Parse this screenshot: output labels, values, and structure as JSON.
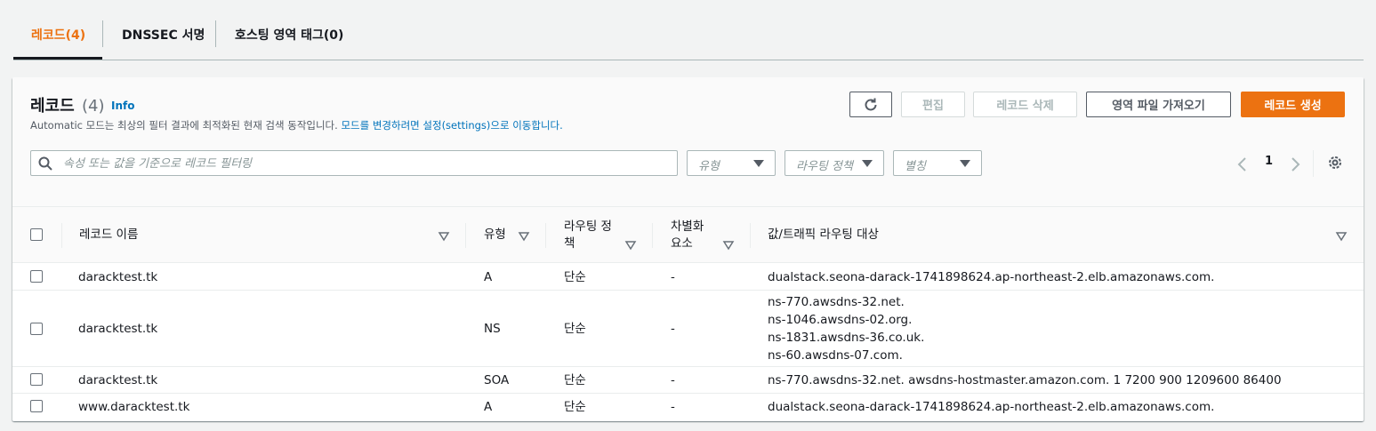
{
  "tabs": [
    {
      "label": "레코드(4)",
      "active": true
    },
    {
      "label": "DNSSEC 서명",
      "active": false
    },
    {
      "label": "호스팅 영역 태그(0)",
      "active": false
    }
  ],
  "panel": {
    "title": "레코드",
    "count": "(4)",
    "info": "Info",
    "description_prefix": "Automatic 모드는 최상의 필터 결과에 최적화된 현재 검색 동작입니다. ",
    "description_link": "모드를 변경하려면 설정(settings)으로 이동합니다."
  },
  "buttons": {
    "refresh_icon": "refresh-icon",
    "edit": "편집",
    "delete": "레코드 삭제",
    "import": "영역 파일 가져오기",
    "create": "레코드 생성"
  },
  "search": {
    "placeholder": "속성 또는 값을 기준으로 레코드 필터링"
  },
  "filters": {
    "type": "유형",
    "routing": "라우팅 정책",
    "alias": "별칭"
  },
  "pagination": {
    "page": "1"
  },
  "columns": {
    "name": "레코드 이름",
    "type": "유형",
    "routing": "라우팅 정책",
    "routing_line1": "라우팅 정",
    "routing_line2": "책",
    "differentiator": "차별화 요소",
    "diff_line1": "차별화",
    "diff_line2": "요소",
    "value": "값/트래픽 라우팅 대상"
  },
  "rows": [
    {
      "name": "daracktest.tk",
      "type": "A",
      "routing": "단순",
      "diff": "-",
      "values": [
        "dualstack.seona-darack-1741898624.ap-northeast-2.elb.amazonaws.com."
      ]
    },
    {
      "name": "daracktest.tk",
      "type": "NS",
      "routing": "단순",
      "diff": "-",
      "values": [
        "ns-770.awsdns-32.net.",
        "ns-1046.awsdns-02.org.",
        "ns-1831.awsdns-36.co.uk.",
        "ns-60.awsdns-07.com."
      ]
    },
    {
      "name": "daracktest.tk",
      "type": "SOA",
      "routing": "단순",
      "diff": "-",
      "values": [
        "ns-770.awsdns-32.net. awsdns-hostmaster.amazon.com. 1 7200 900 1209600 86400"
      ]
    },
    {
      "name": "www.daracktest.tk",
      "type": "A",
      "routing": "단순",
      "diff": "-",
      "values": [
        "dualstack.seona-darack-1741898624.ap-northeast-2.elb.amazonaws.com."
      ]
    }
  ],
  "colors": {
    "accent": "#ec7211",
    "link": "#0073bb",
    "text": "#16191f"
  }
}
